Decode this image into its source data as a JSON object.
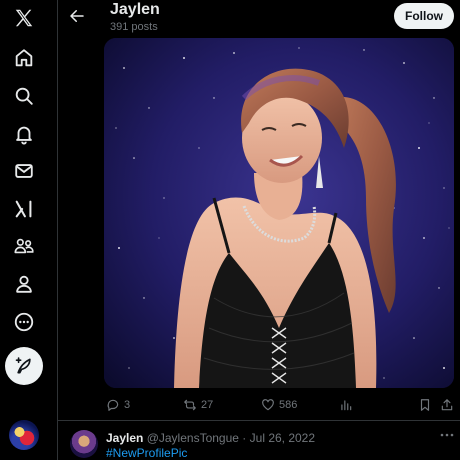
{
  "header": {
    "name": "Jaylen",
    "posts_count": "391 posts",
    "follow_label": "Follow"
  },
  "nav": {
    "icons": [
      "x-logo-icon",
      "home-icon",
      "search-icon",
      "notifications-bell-icon",
      "messages-envelope-icon",
      "grok-icon",
      "communities-icon",
      "profile-icon",
      "more-circle-icon"
    ],
    "compose_icon": "compose-feather-icon"
  },
  "media": {
    "description_alt": "Profile picture photo"
  },
  "actions": {
    "replies": "3",
    "reposts": "27",
    "likes": "586",
    "views": "",
    "icons": [
      "reply-icon",
      "repost-icon",
      "like-icon",
      "views-icon",
      "bookmark-icon",
      "share-icon"
    ]
  },
  "next_post": {
    "name": "Jaylen",
    "handle": "@JaylensTongue",
    "separator": "·",
    "date": "Jul 26, 2022",
    "hashtag": "#NewProfilePic"
  },
  "colors": {
    "background": "#000000",
    "text": "#e7e9ea",
    "muted": "#71767b",
    "accent": "#1d9bf0",
    "button": "#eff3f4"
  }
}
